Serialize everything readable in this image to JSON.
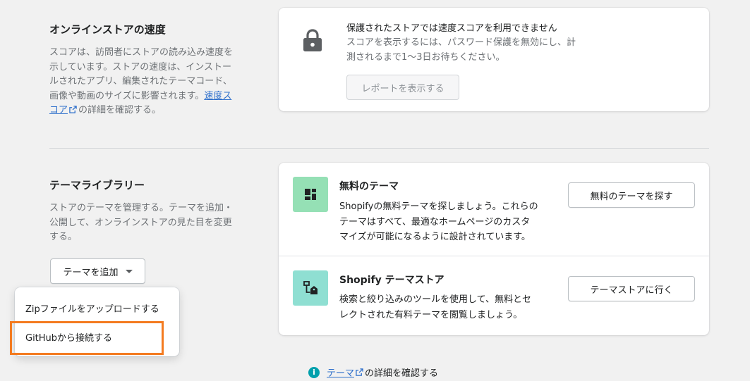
{
  "speed": {
    "title": "オンラインストアの速度",
    "desc_line1": "スコアは、訪問者にストアの読み込み速度を",
    "desc_line2": "示しています。ストアの速度は、インストー",
    "desc_line3": "ルされたアプリ、編集されたテーマコード、",
    "desc_line4_pre": "画像や動画のサイズに影響されます。",
    "link_part1": "速度ス",
    "link_part2": "コア",
    "desc_after_link": "の詳細を確認する。",
    "card_title": "保護されたストアでは速度スコアを利用できません",
    "card_desc_line1": "スコアを表示するには、パスワード保護を無効にし、計",
    "card_desc_line2": "測されるまで1〜3日お待ちください。",
    "report_button": "レポートを表示する",
    "lock_icon": "lock-icon"
  },
  "library": {
    "title": "テーマライブラリー",
    "desc_line1": "ストアのテーマを管理する。テーマを追加・",
    "desc_line2": "公開して、オンラインストアの見た目を変更",
    "desc_line3": "する。",
    "add_button": "テーマを追加",
    "free": {
      "title": "無料のテーマ",
      "desc_line1": "Shopifyの無料テーマを探しましょう。これらの",
      "desc_line2": "テーマはすべて、最適なホームページのカスタ",
      "desc_line3": "マイズが可能になるように設計されています。",
      "button": "無料のテーマを探す",
      "thumb_color": "#95e0b5"
    },
    "store": {
      "title": "Shopify テーマストア",
      "desc_line1": "検索と絞り込みのツールを使用して、無料とセ",
      "desc_line2": "レクトされた有料テーマを閲覧しましょう。",
      "button": "テーマストアに行く",
      "thumb_color": "#8fdfd2"
    }
  },
  "menu": {
    "items": [
      {
        "label": "Zipファイルをアップロードする"
      },
      {
        "label": "GitHubから接続する"
      }
    ],
    "highlight_color": "#f47b20"
  },
  "footer": {
    "link": "テーマ",
    "text": "の詳細を確認する"
  }
}
